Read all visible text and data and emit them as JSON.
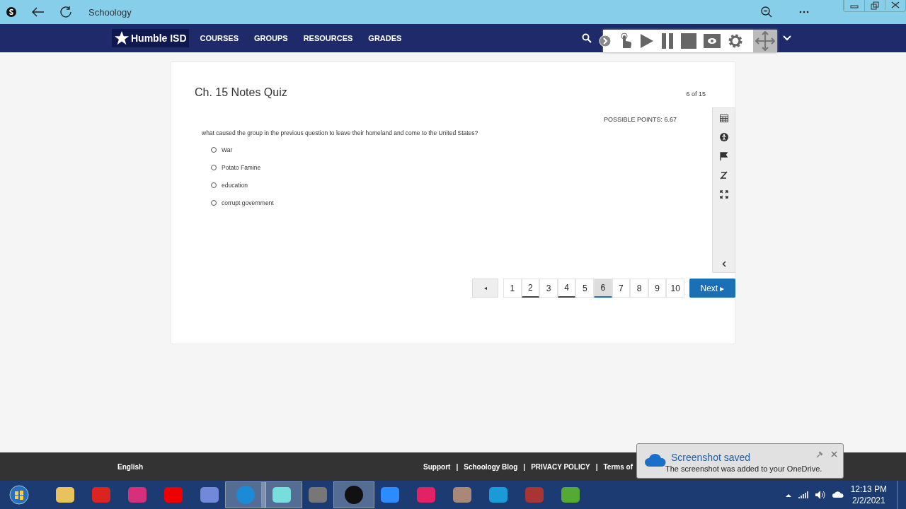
{
  "browser": {
    "title": "Schoology"
  },
  "nav": {
    "logo": "Humble ISD",
    "items": [
      "COURSES",
      "GROUPS",
      "RESOURCES",
      "GRADES"
    ]
  },
  "quiz": {
    "title": "Ch. 15 Notes Quiz",
    "progress": "6 of 15",
    "points": "POSSIBLE POINTS: 6.67",
    "question": "what caused the group in the previous question to leave their homeland and come to the United States?",
    "choices": [
      {
        "label": "War",
        "selected": false
      },
      {
        "label": "Potato Famine",
        "selected": false
      },
      {
        "label": "education",
        "selected": false
      },
      {
        "label": "corrupt government",
        "selected": false
      }
    ]
  },
  "pagination": {
    "prev": "◂",
    "next": "Next ▸",
    "pages": [
      {
        "label": "1",
        "selected": false,
        "answered": false
      },
      {
        "label": "2",
        "selected": false,
        "answered": true
      },
      {
        "label": "3",
        "selected": false,
        "answered": false
      },
      {
        "label": "4",
        "selected": false,
        "answered": true
      },
      {
        "label": "5",
        "selected": false,
        "answered": false
      },
      {
        "label": "6",
        "selected": true,
        "answered": false
      },
      {
        "label": "7",
        "selected": false,
        "answered": false
      },
      {
        "label": "8",
        "selected": false,
        "answered": false
      },
      {
        "label": "9",
        "selected": false,
        "answered": false
      },
      {
        "label": "10",
        "selected": false,
        "answered": false
      }
    ]
  },
  "footer": {
    "language": "English",
    "separator": "|",
    "links": [
      "Support",
      "Schoology Blog",
      "PRIVACY POLICY",
      "Terms of"
    ]
  },
  "toast": {
    "title": "Screenshot saved",
    "message": "The screenshot was added to your OneDrive."
  },
  "taskbar": {
    "time": "12:13 PM",
    "date": "2/2/2021"
  }
}
